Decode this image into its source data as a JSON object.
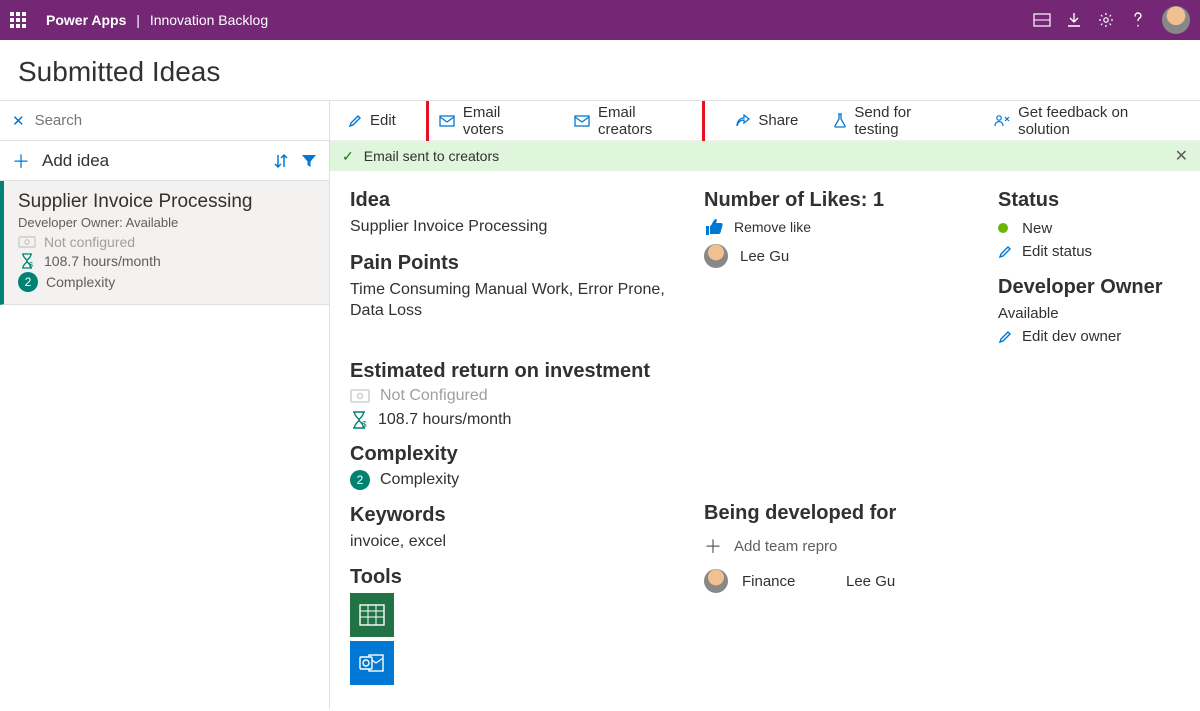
{
  "header": {
    "brand": "Power Apps",
    "app": "Innovation Backlog"
  },
  "page": {
    "title": "Submitted Ideas"
  },
  "sidebar": {
    "search_placeholder": "Search",
    "add_label": "Add idea",
    "idea": {
      "title": "Supplier Invoice Processing",
      "owner_line": "Developer Owner: Available",
      "not_configured": "Not configured",
      "hours": "108.7 hours/month",
      "complexity_label": "Complexity",
      "complexity_value": "2"
    }
  },
  "toolbar": {
    "edit": "Edit",
    "email_voters": "Email voters",
    "email_creators": "Email creators",
    "share": "Share",
    "send_testing": "Send for testing",
    "get_feedback": "Get feedback on solution"
  },
  "notification": {
    "message": "Email sent to creators"
  },
  "detail": {
    "idea_label": "Idea",
    "idea_value": "Supplier Invoice Processing",
    "pain_label": "Pain Points",
    "pain_value": "Time Consuming Manual Work, Error Prone, Data Loss",
    "roi_label": "Estimated return on investment",
    "roi_not_configured": "Not Configured",
    "roi_hours": "108.7 hours/month",
    "complexity_label": "Complexity",
    "complexity_badge": "2",
    "complexity_value": "Complexity",
    "keywords_label": "Keywords",
    "keywords_value": "invoice, excel",
    "tools_label": "Tools",
    "likes_label": "Number of Likes: 1",
    "remove_like": "Remove like",
    "liker": "Lee Gu",
    "developed_label": "Being developed for",
    "add_team": "Add team repro",
    "team_name": "Finance",
    "team_person": "Lee Gu",
    "status_label": "Status",
    "status_value": "New",
    "edit_status": "Edit status",
    "dev_owner_label": "Developer Owner",
    "dev_owner_value": "Available",
    "edit_dev_owner": "Edit dev owner"
  }
}
